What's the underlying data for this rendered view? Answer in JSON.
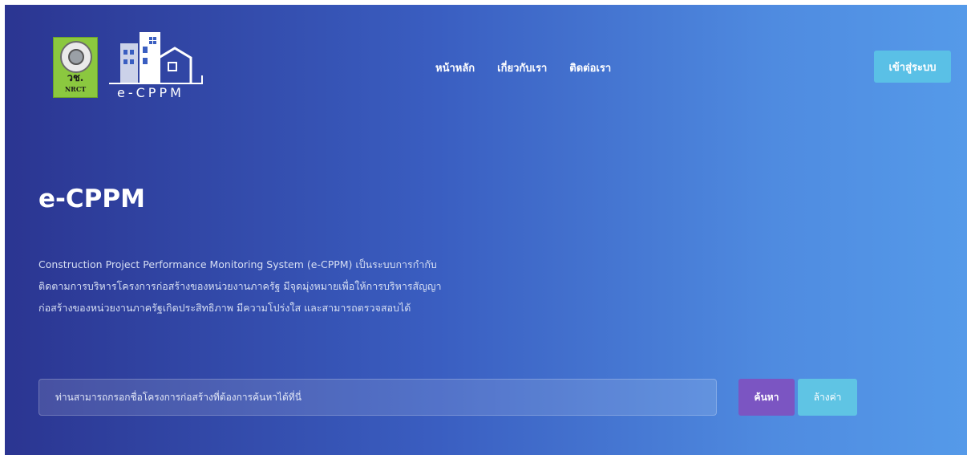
{
  "header": {
    "org_logo": {
      "icon": "nrct-seal-logo",
      "text_th": "วช.",
      "text_en": "NRCT",
      "color": "#8bc83f"
    },
    "app_logo": {
      "icon": "buildings-logo",
      "wordmark": "e-CPPM"
    },
    "nav": [
      {
        "label": "หน้าหลัก"
      },
      {
        "label": "เกี่ยวกับเรา"
      },
      {
        "label": "ติดต่อเรา"
      }
    ],
    "login_label": "เข้าสู่ระบบ"
  },
  "hero": {
    "title": "e-CPPM",
    "description_lines": [
      "Construction Project Performance Monitoring System (e-CPPM)   เป็นระบบการกำกับ",
      "ติดตามการบริหารโครงการก่อสร้างของหน่วยงานภาครัฐ มีจุดมุ่งหมายเพื่อให้การบริหารสัญญา",
      "ก่อสร้างของหน่วยงานภาครัฐเกิดประสิทธิภาพ มีความโปร่งใส และสามารถตรวจสอบได้"
    ]
  },
  "search": {
    "placeholder": "ท่านสามารถกรอกชื่อโครงการก่อสร้างที่ต้องการค้นหาได้ที่นี่",
    "value": "",
    "search_label": "ค้นหา",
    "clear_label": "ล้างค่า"
  },
  "colors": {
    "gradient_start": "#2b3591",
    "gradient_end": "#559ae9",
    "login_button": "#5ac0e6",
    "search_button": "#7b55c2",
    "clear_button": "#5fc4e4"
  }
}
